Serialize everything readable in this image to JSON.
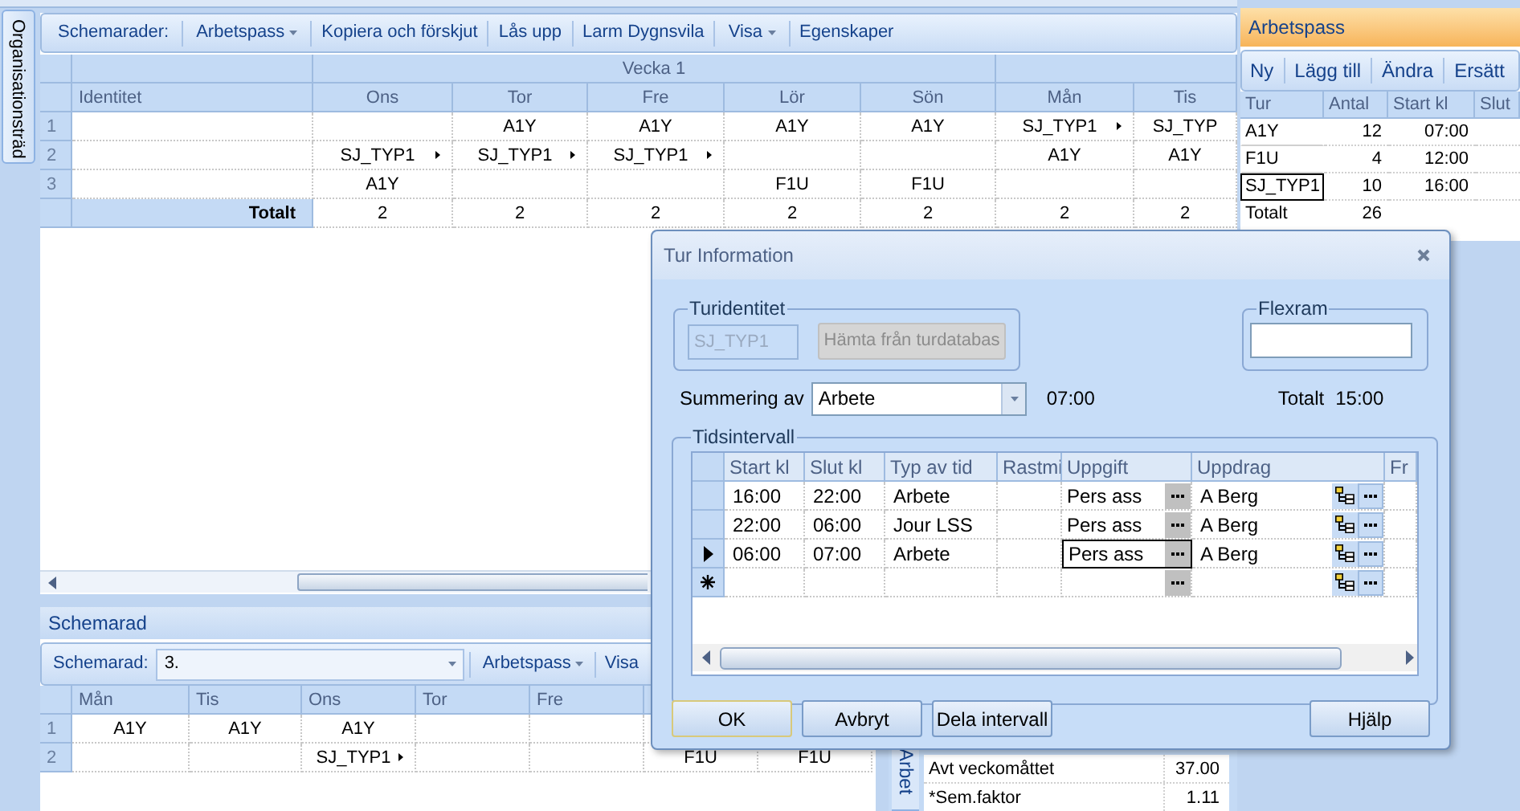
{
  "side_tab": {
    "label": "Organisationsträd"
  },
  "schedule_panel": {
    "toolbar": [
      {
        "label": "Schemarader:",
        "kind": "label"
      },
      {
        "label": "Arbetspass",
        "kind": "dropdown"
      },
      {
        "label": "Kopiera och förskjut",
        "kind": "button"
      },
      {
        "label": "Lås upp",
        "kind": "button"
      },
      {
        "label": "Larm Dygnsvila",
        "kind": "button"
      },
      {
        "label": "Visa",
        "kind": "dropdown"
      },
      {
        "label": "Egenskaper",
        "kind": "button"
      }
    ],
    "week_label": "Vecka 1",
    "identity_column": "Identitet",
    "days": [
      "Ons",
      "Tor",
      "Fre",
      "Lör",
      "Sön",
      "Mån",
      "Tis"
    ],
    "rows": [
      {
        "number": "1",
        "cells": [
          null,
          {
            "text": "A1Y",
            "arrow": false
          },
          {
            "text": "A1Y",
            "arrow": false
          },
          {
            "text": "A1Y",
            "arrow": false
          },
          {
            "text": "A1Y",
            "arrow": false
          },
          {
            "text": "SJ_TYP1",
            "arrow": true
          },
          {
            "text": "SJ_TYP",
            "arrow": false
          }
        ]
      },
      {
        "number": "2",
        "cells": [
          {
            "text": "SJ_TYP1",
            "arrow": true
          },
          {
            "text": "SJ_TYP1",
            "arrow": true
          },
          {
            "text": "SJ_TYP1",
            "arrow": true
          },
          null,
          null,
          {
            "text": "A1Y",
            "arrow": false
          },
          {
            "text": "A1Y",
            "arrow": false
          }
        ]
      },
      {
        "number": "3",
        "cells": [
          {
            "text": "A1Y",
            "arrow": false
          },
          null,
          null,
          {
            "text": "F1U",
            "arrow": false
          },
          {
            "text": "F1U",
            "arrow": false
          },
          null,
          null
        ]
      }
    ],
    "totals": {
      "label": "Totalt",
      "values": [
        "2",
        "2",
        "2",
        "2",
        "2",
        "2",
        "2"
      ]
    }
  },
  "shifts_panel": {
    "title": "Arbetspass",
    "toolbar": [
      "Ny",
      "Lägg till",
      "Ändra",
      "Ersätt"
    ],
    "columns": [
      "Tur",
      "Antal",
      "Start kl",
      "Slut"
    ],
    "rows": [
      {
        "tur": "A1Y",
        "antal": "12",
        "start": "07:00",
        "selected": false
      },
      {
        "tur": "F1U",
        "antal": "4",
        "start": "12:00",
        "selected": false
      },
      {
        "tur": "SJ_TYP1",
        "antal": "10",
        "start": "16:00",
        "selected": true
      }
    ],
    "total": {
      "label": "Totalt",
      "value": "26"
    }
  },
  "row_panel": {
    "title": "Schemarad",
    "toolbar_label": "Schemarad:",
    "row_value": "3.",
    "toolbar": [
      {
        "label": "Arbetspass",
        "kind": "dropdown"
      },
      {
        "label": "Visa",
        "kind": "button"
      }
    ],
    "columns": [
      "Mån",
      "Tis",
      "Ons",
      "Tor",
      "Fre"
    ],
    "rows": [
      {
        "number": "1",
        "cells": [
          {
            "text": "A1Y",
            "arrow": false
          },
          {
            "text": "A1Y",
            "arrow": false
          },
          {
            "text": "A1Y",
            "arrow": false
          },
          null,
          null,
          null,
          null
        ]
      },
      {
        "number": "2",
        "cells": [
          null,
          null,
          {
            "text": "SJ_TYP1",
            "arrow": true
          },
          null,
          null,
          {
            "text": "F1U",
            "arrow": false
          },
          {
            "text": "F1U",
            "arrow": false
          }
        ]
      }
    ]
  },
  "stats_panel": {
    "tab": "Arbet",
    "rows": [
      {
        "label": "Avt veckomåttet",
        "value": "37.00"
      },
      {
        "label": "*Sem.faktor",
        "value": "1.11"
      }
    ]
  },
  "dialog": {
    "title": "Tur Information",
    "identity_group": {
      "legend": "Turidentitet",
      "value": "SJ_TYP1",
      "button": "Hämta från turdatabas",
      "disabled": true
    },
    "flex_group": {
      "legend": "Flexram"
    },
    "summary": {
      "label": "Summering av",
      "value": "Arbete",
      "time": "07:00",
      "total_label": "Totalt",
      "total": "15:00"
    },
    "interval_group": {
      "legend": "Tidsintervall",
      "columns": [
        "Start kl",
        "Slut kl",
        "Typ av tid",
        "Rastmi",
        "Uppgift",
        "Uppdrag",
        "Fr"
      ],
      "rows": [
        {
          "kind": "data",
          "start": "16:00",
          "end": "22:00",
          "type": "Arbete",
          "task": "Pers ass",
          "assignment": "A Berg",
          "selected": false
        },
        {
          "kind": "data",
          "start": "22:00",
          "end": "06:00",
          "type": "Jour LSS",
          "task": "Pers ass",
          "assignment": "A Berg",
          "selected": false
        },
        {
          "kind": "data",
          "start": "06:00",
          "end": "07:00",
          "type": "Arbete",
          "task": "Pers ass",
          "assignment": "A Berg",
          "selected": true
        },
        {
          "kind": "new"
        }
      ]
    },
    "buttons": [
      {
        "label": "OK",
        "default": true
      },
      {
        "label": "Avbryt",
        "default": false
      },
      {
        "label": "Dela intervall",
        "default": false
      },
      {
        "label": "Hjälp",
        "default": false
      }
    ]
  }
}
